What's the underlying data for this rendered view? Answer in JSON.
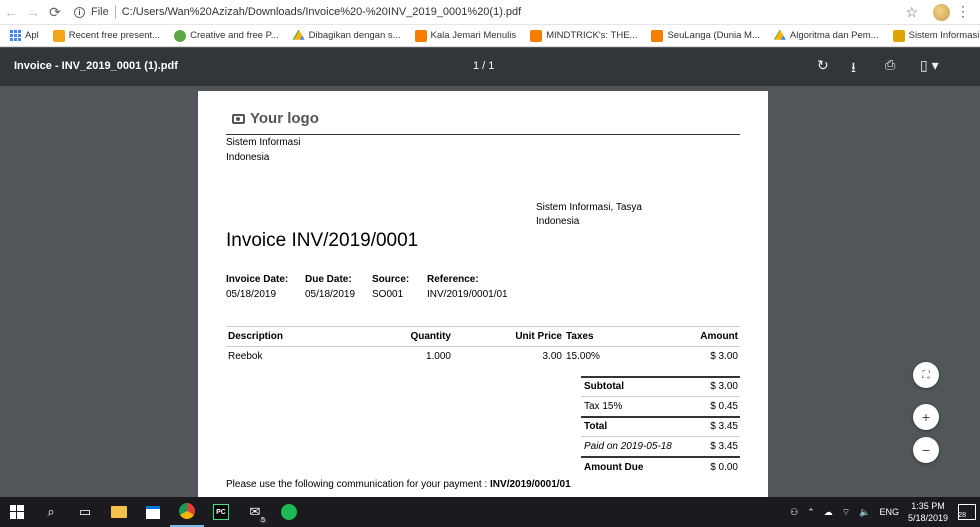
{
  "browser": {
    "url_label": "File",
    "url": "C:/Users/Wan%20Azizah/Downloads/Invoice%20-%20INV_2019_0001%20(1).pdf"
  },
  "bookmarks": [
    {
      "label": "Apl",
      "color": "#4285f4"
    },
    {
      "label": "Recent free present...",
      "color": "#f4a31a"
    },
    {
      "label": "Creative and free P...",
      "color": "#5aa846"
    },
    {
      "label": "Dibagikan dengan s...",
      "color": "#1a73e8"
    },
    {
      "label": "Kala Jemari Menulis",
      "color": "#f57d00"
    },
    {
      "label": "MINDTRICK's: THE...",
      "color": "#f57d00"
    },
    {
      "label": "SeuLanga (Dunia M...",
      "color": "#f57d00"
    },
    {
      "label": "Algoritma dan Pem...",
      "color": "#1a73e8"
    },
    {
      "label": "Sistem Informasi M...",
      "color": "#e0a400"
    }
  ],
  "pdf": {
    "title": "Invoice - INV_2019_0001 (1).pdf",
    "pages": "1 / 1"
  },
  "invoice": {
    "logo": "Your logo",
    "company": [
      "Sistem Informasi",
      "Indonesia"
    ],
    "customer": [
      "Sistem Informasi, Tasya",
      "Indonesia"
    ],
    "title": "Invoice INV/2019/0001",
    "meta": [
      {
        "label": "Invoice Date:",
        "value": "05/18/2019"
      },
      {
        "label": "Due Date:",
        "value": "05/18/2019"
      },
      {
        "label": "Source:",
        "value": "SO001"
      },
      {
        "label": "Reference:",
        "value": "INV/2019/0001/01"
      }
    ],
    "columns": [
      "Description",
      "Quantity",
      "Unit Price",
      "Taxes",
      "Amount"
    ],
    "lines": [
      {
        "description": "Reebok",
        "quantity": "1.000",
        "unit_price": "3.00",
        "taxes": "15.00%",
        "amount": "$ 3.00"
      }
    ],
    "totals": [
      {
        "label": "Subtotal",
        "value": "$ 3.00"
      },
      {
        "label": "Tax 15%",
        "value": "$ 0.45"
      },
      {
        "label": "Total",
        "value": "$ 3.45"
      },
      {
        "label": "Paid on 2019-05-18",
        "value": "$ 3.45"
      },
      {
        "label": "Amount Due",
        "value": "$ 0.00"
      }
    ],
    "communication_prefix": "Please use the following communication for your payment : ",
    "communication_ref": "INV/2019/0001/01"
  },
  "taskbar": {
    "language": "ENG",
    "time": "1:35 PM",
    "date": "5/18/2019",
    "notification_count": "28",
    "mail_badge": "5"
  }
}
